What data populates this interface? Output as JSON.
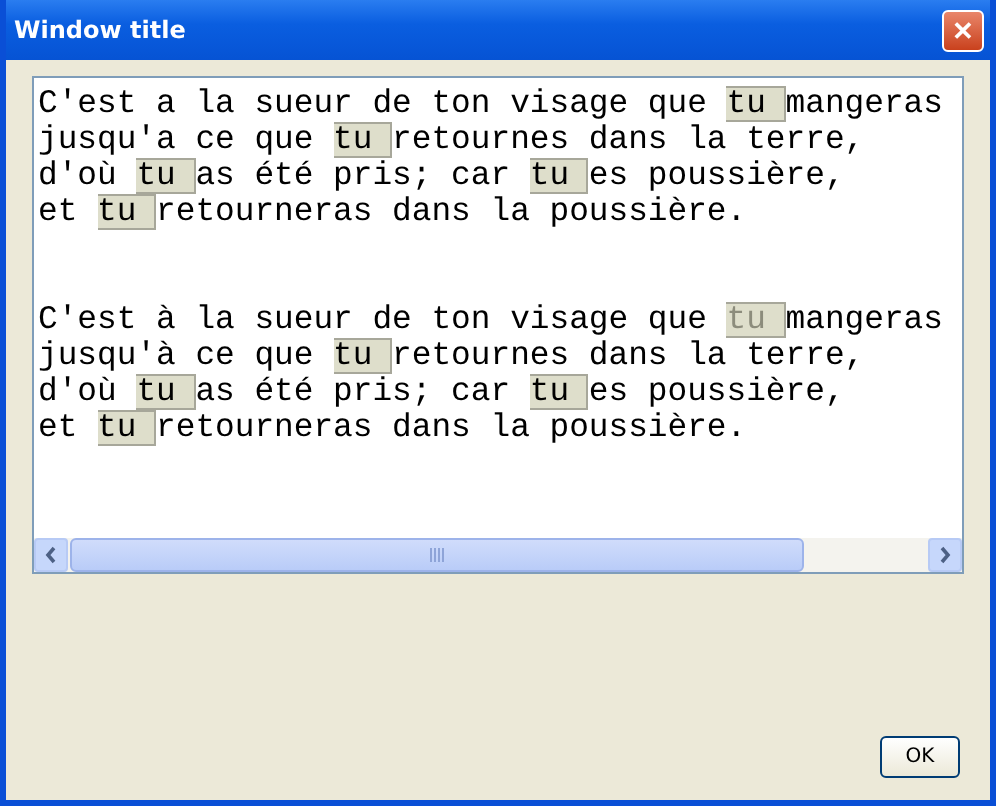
{
  "window": {
    "title": "Window title",
    "close_glyph": "✕"
  },
  "paragraphs": [
    {
      "lines": [
        [
          {
            "kind": "text",
            "text": "C'est a la sueur de ton visage que "
          },
          {
            "kind": "tag",
            "text": "tu",
            "dimmed": false
          },
          {
            "kind": "text",
            "text": "mangeras"
          }
        ],
        [
          {
            "kind": "text",
            "text": "jusqu'a ce que "
          },
          {
            "kind": "tag",
            "text": "tu",
            "dimmed": false
          },
          {
            "kind": "text",
            "text": "retournes dans la terre,"
          }
        ],
        [
          {
            "kind": "text",
            "text": "d'où "
          },
          {
            "kind": "tag",
            "text": "tu",
            "dimmed": false
          },
          {
            "kind": "text",
            "text": "as été pris; car "
          },
          {
            "kind": "tag",
            "text": "tu",
            "dimmed": false
          },
          {
            "kind": "text",
            "text": "es poussière,"
          }
        ],
        [
          {
            "kind": "text",
            "text": "et "
          },
          {
            "kind": "tag",
            "text": "tu",
            "dimmed": false
          },
          {
            "kind": "text",
            "text": "retourneras dans la poussière."
          }
        ]
      ]
    },
    {
      "lines": [
        [
          {
            "kind": "text",
            "text": "C'est à la sueur de ton visage que "
          },
          {
            "kind": "tag",
            "text": "tu",
            "dimmed": true
          },
          {
            "kind": "text",
            "text": "mangeras"
          }
        ],
        [
          {
            "kind": "text",
            "text": "jusqu'à ce que "
          },
          {
            "kind": "tag",
            "text": "tu",
            "dimmed": false
          },
          {
            "kind": "text",
            "text": "retournes dans la terre,"
          }
        ],
        [
          {
            "kind": "text",
            "text": "d'où "
          },
          {
            "kind": "tag",
            "text": "tu",
            "dimmed": false
          },
          {
            "kind": "text",
            "text": "as été pris; car "
          },
          {
            "kind": "tag",
            "text": "tu",
            "dimmed": false
          },
          {
            "kind": "text",
            "text": "es poussière,"
          }
        ],
        [
          {
            "kind": "text",
            "text": "et "
          },
          {
            "kind": "tag",
            "text": "tu",
            "dimmed": false
          },
          {
            "kind": "text",
            "text": "retourneras dans la poussière."
          }
        ]
      ]
    }
  ],
  "buttons": [
    {
      "label": "OK"
    }
  ]
}
